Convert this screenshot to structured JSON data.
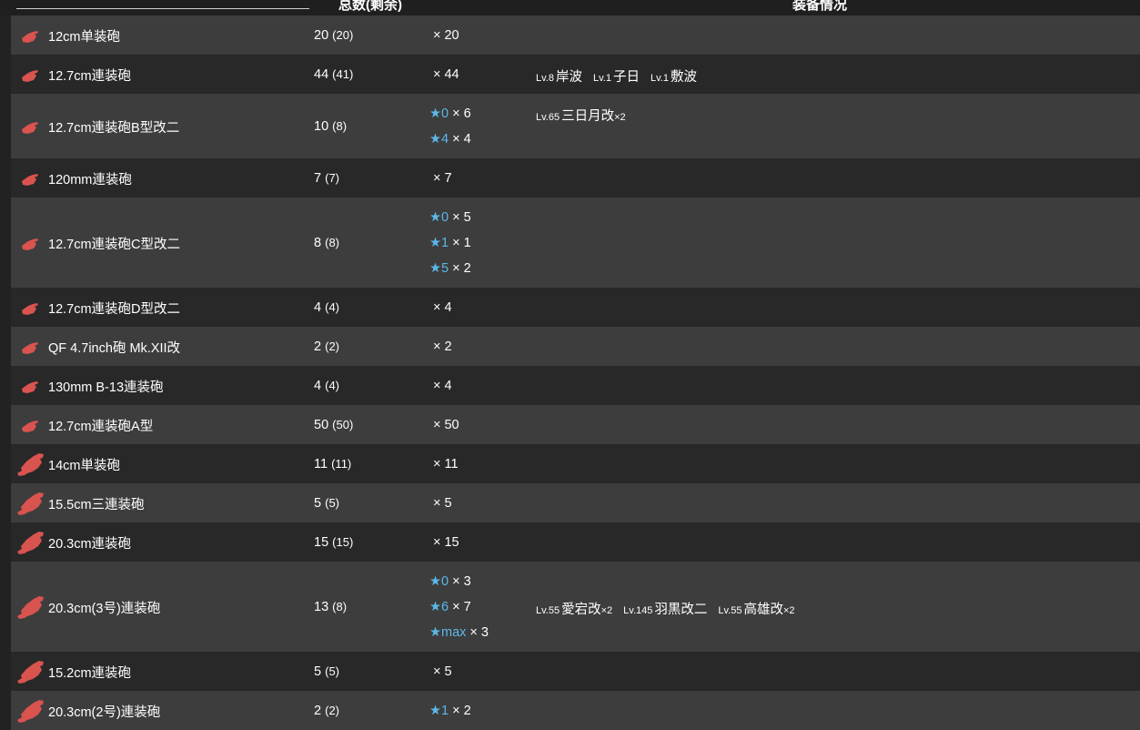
{
  "header": {
    "count_label": "总数(剩余)",
    "equip_label": "装备情况"
  },
  "colors": {
    "row_light": "#3d3d3d",
    "row_dark": "#282828",
    "star": "#5bb8ea",
    "gun_icon": "#d9534f"
  },
  "rows": [
    {
      "name": "12cm单装砲",
      "total": "20",
      "remaining": "(20)",
      "icon": "small-gun-icon",
      "improvements": [
        {
          "star": "",
          "count": "× 20"
        }
      ],
      "equipped": []
    },
    {
      "name": "12.7cm連装砲",
      "total": "44",
      "remaining": "(41)",
      "icon": "small-gun-icon",
      "improvements": [
        {
          "star": "",
          "count": "× 44"
        }
      ],
      "equipped": [
        {
          "lv": "Lv.8",
          "ship": "岸波",
          "mult": ""
        },
        {
          "lv": "Lv.1",
          "ship": "子日",
          "mult": ""
        },
        {
          "lv": "Lv.1",
          "ship": "敷波",
          "mult": ""
        }
      ]
    },
    {
      "name": "12.7cm連装砲B型改二",
      "total": "10",
      "remaining": "(8)",
      "icon": "small-gun-icon",
      "improvements": [
        {
          "star": "★0",
          "count": "× 6"
        },
        {
          "star": "★4",
          "count": "× 4"
        }
      ],
      "equipped": [
        {
          "lv": "Lv.65",
          "ship": "三日月改",
          "mult": "×2"
        }
      ]
    },
    {
      "name": "120mm連装砲",
      "total": "7",
      "remaining": "(7)",
      "icon": "small-gun-icon",
      "improvements": [
        {
          "star": "",
          "count": "× 7"
        }
      ],
      "equipped": []
    },
    {
      "name": "12.7cm連装砲C型改二",
      "total": "8",
      "remaining": "(8)",
      "icon": "small-gun-icon",
      "improvements": [
        {
          "star": "★0",
          "count": "× 5"
        },
        {
          "star": "★1",
          "count": "× 1"
        },
        {
          "star": "★5",
          "count": "× 2"
        }
      ],
      "equipped": []
    },
    {
      "name": "12.7cm連装砲D型改二",
      "total": "4",
      "remaining": "(4)",
      "icon": "small-gun-icon",
      "improvements": [
        {
          "star": "",
          "count": "× 4"
        }
      ],
      "equipped": []
    },
    {
      "name": "QF 4.7inch砲 Mk.XII改",
      "total": "2",
      "remaining": "(2)",
      "icon": "small-gun-icon",
      "improvements": [
        {
          "star": "",
          "count": "× 2"
        }
      ],
      "equipped": []
    },
    {
      "name": "130mm B-13連装砲",
      "total": "4",
      "remaining": "(4)",
      "icon": "small-gun-icon",
      "improvements": [
        {
          "star": "",
          "count": "× 4"
        }
      ],
      "equipped": []
    },
    {
      "name": "12.7cm連装砲A型",
      "total": "50",
      "remaining": "(50)",
      "icon": "small-gun-icon",
      "improvements": [
        {
          "star": "",
          "count": "× 50"
        }
      ],
      "equipped": []
    },
    {
      "name": "14cm単装砲",
      "total": "11",
      "remaining": "(11)",
      "icon": "medium-gun-icon",
      "improvements": [
        {
          "star": "",
          "count": "× 11"
        }
      ],
      "equipped": []
    },
    {
      "name": "15.5cm三連装砲",
      "total": "5",
      "remaining": "(5)",
      "icon": "medium-gun-icon",
      "improvements": [
        {
          "star": "",
          "count": "× 5"
        }
      ],
      "equipped": []
    },
    {
      "name": "20.3cm連装砲",
      "total": "15",
      "remaining": "(15)",
      "icon": "medium-gun-icon",
      "improvements": [
        {
          "star": "",
          "count": "× 15"
        }
      ],
      "equipped": []
    },
    {
      "name": "20.3cm(3号)連装砲",
      "total": "13",
      "remaining": "(8)",
      "icon": "medium-gun-icon",
      "improvements": [
        {
          "star": "★0",
          "count": "× 3"
        },
        {
          "star": "★6",
          "count": "× 7"
        },
        {
          "star": "★max",
          "count": "× 3"
        }
      ],
      "equipped": [
        {
          "lv": "Lv.55",
          "ship": "愛宕改",
          "mult": "×2"
        },
        {
          "lv": "Lv.145",
          "ship": "羽黒改二",
          "mult": ""
        },
        {
          "lv": "Lv.55",
          "ship": "高雄改",
          "mult": "×2"
        }
      ]
    },
    {
      "name": "15.2cm連装砲",
      "total": "5",
      "remaining": "(5)",
      "icon": "medium-gun-icon",
      "improvements": [
        {
          "star": "",
          "count": "× 5"
        }
      ],
      "equipped": []
    },
    {
      "name": "20.3cm(2号)連装砲",
      "total": "2",
      "remaining": "(2)",
      "icon": "medium-gun-icon",
      "improvements": [
        {
          "star": "★1",
          "count": "× 2"
        }
      ],
      "equipped": []
    }
  ]
}
